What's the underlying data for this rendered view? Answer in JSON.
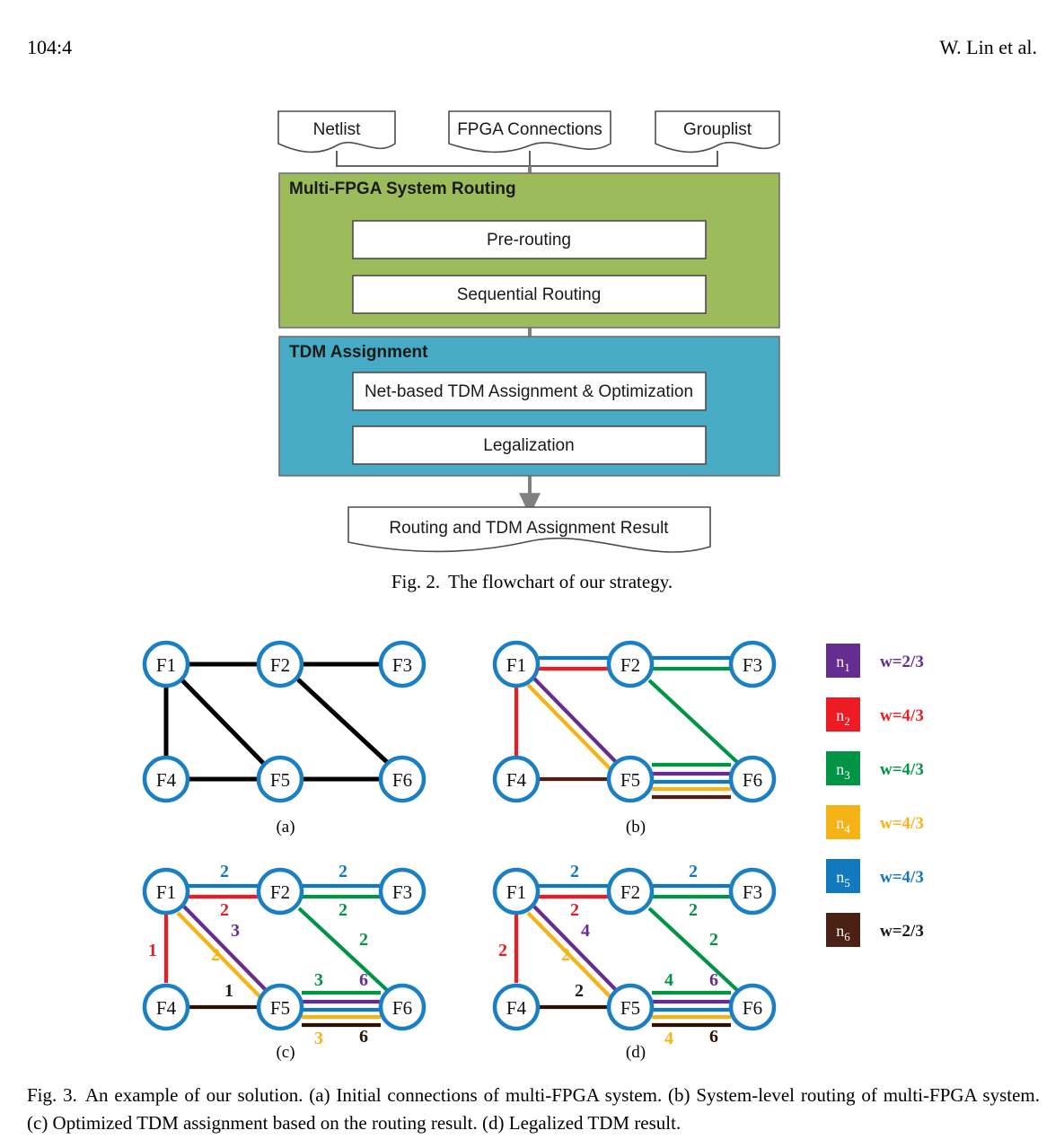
{
  "header": {
    "page_number": "104:4",
    "authors": "W. Lin et al."
  },
  "figure2": {
    "inputs": [
      {
        "label": "Netlist"
      },
      {
        "label": "FPGA Connections"
      },
      {
        "label": "Grouplist"
      }
    ],
    "groups": [
      {
        "title": "Multi-FPGA System Routing",
        "color": "#9CBB5B",
        "steps": [
          "Pre-routing",
          "Sequential Routing"
        ]
      },
      {
        "title": "TDM Assignment",
        "color": "#48ABC6",
        "steps": [
          "Net-based TDM Assignment & Optimization",
          "Legalization"
        ]
      }
    ],
    "output": {
      "label": "Routing and TDM Assignment Result"
    },
    "caption_tag": "Fig. 2.",
    "caption_text": "The flowchart of our strategy."
  },
  "figure3": {
    "caption_tag": "Fig. 3.",
    "caption_text": "An example of our solution. (a) Initial connections of multi-FPGA system. (b) System-level routing of multi-FPGA system. (c) Optimized TDM assignment based on the routing result. (d) Legalized TDM result.",
    "node_labels": [
      "F1",
      "F2",
      "F3",
      "F4",
      "F5",
      "F6"
    ],
    "panels": [
      {
        "letter": "(a)",
        "title": "Initial connections"
      },
      {
        "letter": "(b)",
        "title": "System-level routing"
      },
      {
        "letter": "(c)",
        "title": "Optimized TDM assignment"
      },
      {
        "letter": "(d)",
        "title": "Legalized TDM result"
      }
    ],
    "legend": [
      {
        "net": "n",
        "sub": "1",
        "color": "#662D91",
        "weight": "w=2/3"
      },
      {
        "net": "n",
        "sub": "2",
        "color": "#ED1C24",
        "weight": "w=4/3"
      },
      {
        "net": "n",
        "sub": "3",
        "color": "#009444",
        "weight": "w=4/3"
      },
      {
        "net": "n",
        "sub": "4",
        "color": "#F5B315",
        "weight": "w=4/3"
      },
      {
        "net": "n",
        "sub": "5",
        "color": "#1379BF",
        "weight": "w=4/3"
      },
      {
        "net": "n",
        "sub": "6",
        "color": "#4B2114",
        "weight": "w=2/3"
      }
    ],
    "panel_c_labels": {
      "f1_f2_top": "2",
      "f1_f2_bot": "2",
      "f2_f3_top": "2",
      "f2_f3_bot": "2",
      "f1_f4": "1",
      "f1_f5_purple": "3",
      "f1_f5_yellow": "2",
      "f2_f6": "2",
      "f4_f5": "1",
      "f5_f6_green": "3",
      "f5_f6_purple": "6",
      "f5_f6_yellow": "3",
      "f5_f6_brown": "6"
    },
    "panel_d_labels": {
      "f1_f2_top": "2",
      "f1_f2_bot": "2",
      "f2_f3_top": "2",
      "f2_f3_bot": "2",
      "f1_f4": "2",
      "f1_f5_purple": "4",
      "f1_f5_yellow": "2",
      "f2_f6": "2",
      "f4_f5": "2",
      "f5_f6_green": "4",
      "f5_f6_purple": "6",
      "f5_f6_yellow": "4",
      "f5_f6_brown": "6"
    }
  },
  "chart_data": {
    "type": "diagram",
    "title": "Multi-FPGA routing & TDM assignment example",
    "graph_nodes": [
      "F1",
      "F2",
      "F3",
      "F4",
      "F5",
      "F6"
    ],
    "graph_edges": [
      {
        "from": "F1",
        "to": "F2"
      },
      {
        "from": "F2",
        "to": "F3"
      },
      {
        "from": "F1",
        "to": "F4"
      },
      {
        "from": "F1",
        "to": "F5"
      },
      {
        "from": "F2",
        "to": "F6"
      },
      {
        "from": "F4",
        "to": "F5"
      },
      {
        "from": "F5",
        "to": "F6"
      }
    ],
    "net_routes": {
      "n1": [
        "F1-F5",
        "F5-F6"
      ],
      "n2": [
        "F1-F2",
        "F1-F4"
      ],
      "n3": [
        "F2-F3",
        "F2-F6",
        "F5-F6"
      ],
      "n4": [
        "F1-F5",
        "F5-F6"
      ],
      "n5": [
        "F1-F2",
        "F2-F3",
        "F5-F6"
      ],
      "n6": [
        "F4-F5",
        "F5-F6"
      ]
    },
    "net_weights": {
      "n1": "2/3",
      "n2": "4/3",
      "n3": "4/3",
      "n4": "4/3",
      "n5": "4/3",
      "n6": "2/3"
    },
    "tdm_optimized": {
      "F1-F2": {
        "n5": 2,
        "n2": 2
      },
      "F2-F3": {
        "n5": 2,
        "n3": 2
      },
      "F1-F4": {
        "n2": 1
      },
      "F1-F5": {
        "n1": 3,
        "n4": 2
      },
      "F2-F6": {
        "n3": 2
      },
      "F4-F5": {
        "n6": 1
      },
      "F5-F6": {
        "n3": 3,
        "n1": 6,
        "n4": 3,
        "n6": 6
      }
    },
    "tdm_legalized": {
      "F1-F2": {
        "n5": 2,
        "n2": 2
      },
      "F2-F3": {
        "n5": 2,
        "n3": 2
      },
      "F1-F4": {
        "n2": 2
      },
      "F1-F5": {
        "n1": 4,
        "n4": 2
      },
      "F2-F6": {
        "n3": 2
      },
      "F4-F5": {
        "n6": 2
      },
      "F5-F6": {
        "n3": 4,
        "n1": 6,
        "n4": 4,
        "n6": 6
      }
    }
  }
}
